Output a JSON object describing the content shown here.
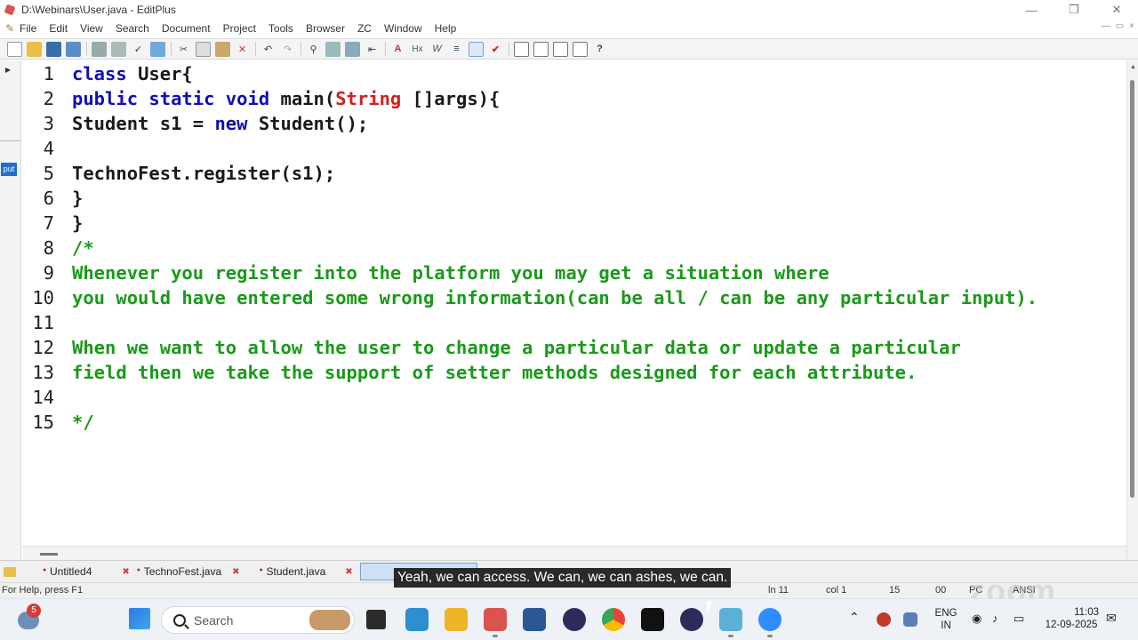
{
  "window": {
    "title": "D:\\Webinars\\User.java - EditPlus"
  },
  "menu": [
    "File",
    "Edit",
    "View",
    "Search",
    "Document",
    "Project",
    "Tools",
    "Browser",
    "ZC",
    "Window",
    "Help"
  ],
  "code": {
    "lines": [
      {
        "n": "1",
        "parts": [
          {
            "t": "class ",
            "c": "kw"
          },
          {
            "t": "User{",
            "c": "tx"
          }
        ]
      },
      {
        "n": "2",
        "parts": [
          {
            "t": "public static void ",
            "c": "kw"
          },
          {
            "t": "main(",
            "c": "tx"
          },
          {
            "t": "String",
            "c": "ty"
          },
          {
            "t": " []args){",
            "c": "tx"
          }
        ]
      },
      {
        "n": "3",
        "parts": [
          {
            "t": "Student s1 = ",
            "c": "tx"
          },
          {
            "t": "new",
            "c": "kw"
          },
          {
            "t": " Student();",
            "c": "tx"
          }
        ]
      },
      {
        "n": "4",
        "parts": []
      },
      {
        "n": "5",
        "parts": [
          {
            "t": "TechnoFest.register(s1);",
            "c": "tx"
          }
        ]
      },
      {
        "n": "6",
        "parts": [
          {
            "t": "}",
            "c": "tx"
          }
        ]
      },
      {
        "n": "7",
        "parts": [
          {
            "t": "}",
            "c": "tx"
          }
        ]
      },
      {
        "n": "8",
        "parts": [
          {
            "t": "/*",
            "c": "cm"
          }
        ]
      },
      {
        "n": "9",
        "parts": [
          {
            "t": "Whenever you register into the platform you may get a situation where",
            "c": "cm"
          }
        ]
      },
      {
        "n": "10",
        "parts": [
          {
            "t": "you would have entered some wrong information(can be all / can be any particular input).",
            "c": "cm"
          }
        ]
      },
      {
        "n": "11",
        "parts": []
      },
      {
        "n": "12",
        "parts": [
          {
            "t": "When we want to allow the user to change a particular data or update a particular",
            "c": "cm"
          }
        ]
      },
      {
        "n": "13",
        "parts": [
          {
            "t": "field then we take the support of setter methods designed for each attribute.",
            "c": "cm"
          }
        ]
      },
      {
        "n": "14",
        "parts": []
      },
      {
        "n": "15",
        "parts": [
          {
            "t": "*/",
            "c": "cm"
          }
        ]
      }
    ]
  },
  "left_panel": {
    "tag": "put"
  },
  "tabs": [
    {
      "label": "Untitled4"
    },
    {
      "label": "TechnoFest.java"
    },
    {
      "label": "Student.java"
    }
  ],
  "status": {
    "help": "For Help, press F1",
    "ln": "ln 11",
    "col": "col 1",
    "num": "15",
    "mode": "00",
    "pc": "PC",
    "enc": "ANSI"
  },
  "caption": "Yeah, we can access. We can, we can ashes, we can.",
  "watermark": "zoom",
  "taskbar": {
    "search_placeholder": "Search",
    "notification_count": "5",
    "language": "ENG",
    "region": "IN",
    "time": "11:03",
    "date": "12-09-2025"
  },
  "colors": {
    "keyword": "#1010b0",
    "type": "#d02020",
    "comment": "#1a9a1a",
    "text": "#1a1a1a"
  }
}
